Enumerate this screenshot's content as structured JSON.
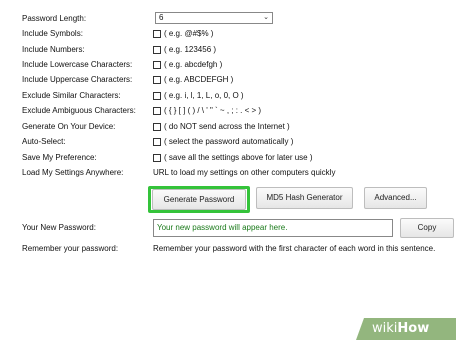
{
  "form": {
    "length_label": "Password Length:",
    "length_value": "6",
    "options": [
      {
        "label": "Include Symbols:",
        "desc": "( e.g. @#$% )"
      },
      {
        "label": "Include Numbers:",
        "desc": "( e.g. 123456 )"
      },
      {
        "label": "Include Lowercase Characters:",
        "desc": "( e.g. abcdefgh )"
      },
      {
        "label": "Include Uppercase Characters:",
        "desc": "( e.g. ABCDEFGH )"
      },
      {
        "label": "Exclude Similar Characters:",
        "desc": "( e.g. i, l, 1, L, o, 0, O )"
      },
      {
        "label": "Exclude Ambiguous Characters:",
        "desc": "( { } [ ] ( ) / \\ ' \" ` ~ , ; : . < > )"
      },
      {
        "label": "Generate On Your Device:",
        "desc": "( do NOT send across the Internet )"
      },
      {
        "label": "Auto-Select:",
        "desc": "( select the password automatically )"
      },
      {
        "label": "Save My Preference:",
        "desc": "( save all the settings above for later use )"
      }
    ],
    "load_label": "Load My Settings Anywhere:",
    "load_text": "URL to load my settings on other computers quickly"
  },
  "buttons": {
    "generate": "Generate Password",
    "md5": "MD5 Hash Generator",
    "advanced": "Advanced..."
  },
  "result": {
    "label": "Your New Password:",
    "placeholder": "Your new password will appear here.",
    "copy": "Copy"
  },
  "remember": {
    "label": "Remember your password:",
    "text": "Remember your password with the first character of each word in this sentence."
  },
  "watermark": {
    "wiki": "wiki",
    "how": "How"
  },
  "colors": {
    "highlight": "#34c33a",
    "placeholder_text": "#1a7a1a",
    "watermark_bg": "#93b67e"
  }
}
